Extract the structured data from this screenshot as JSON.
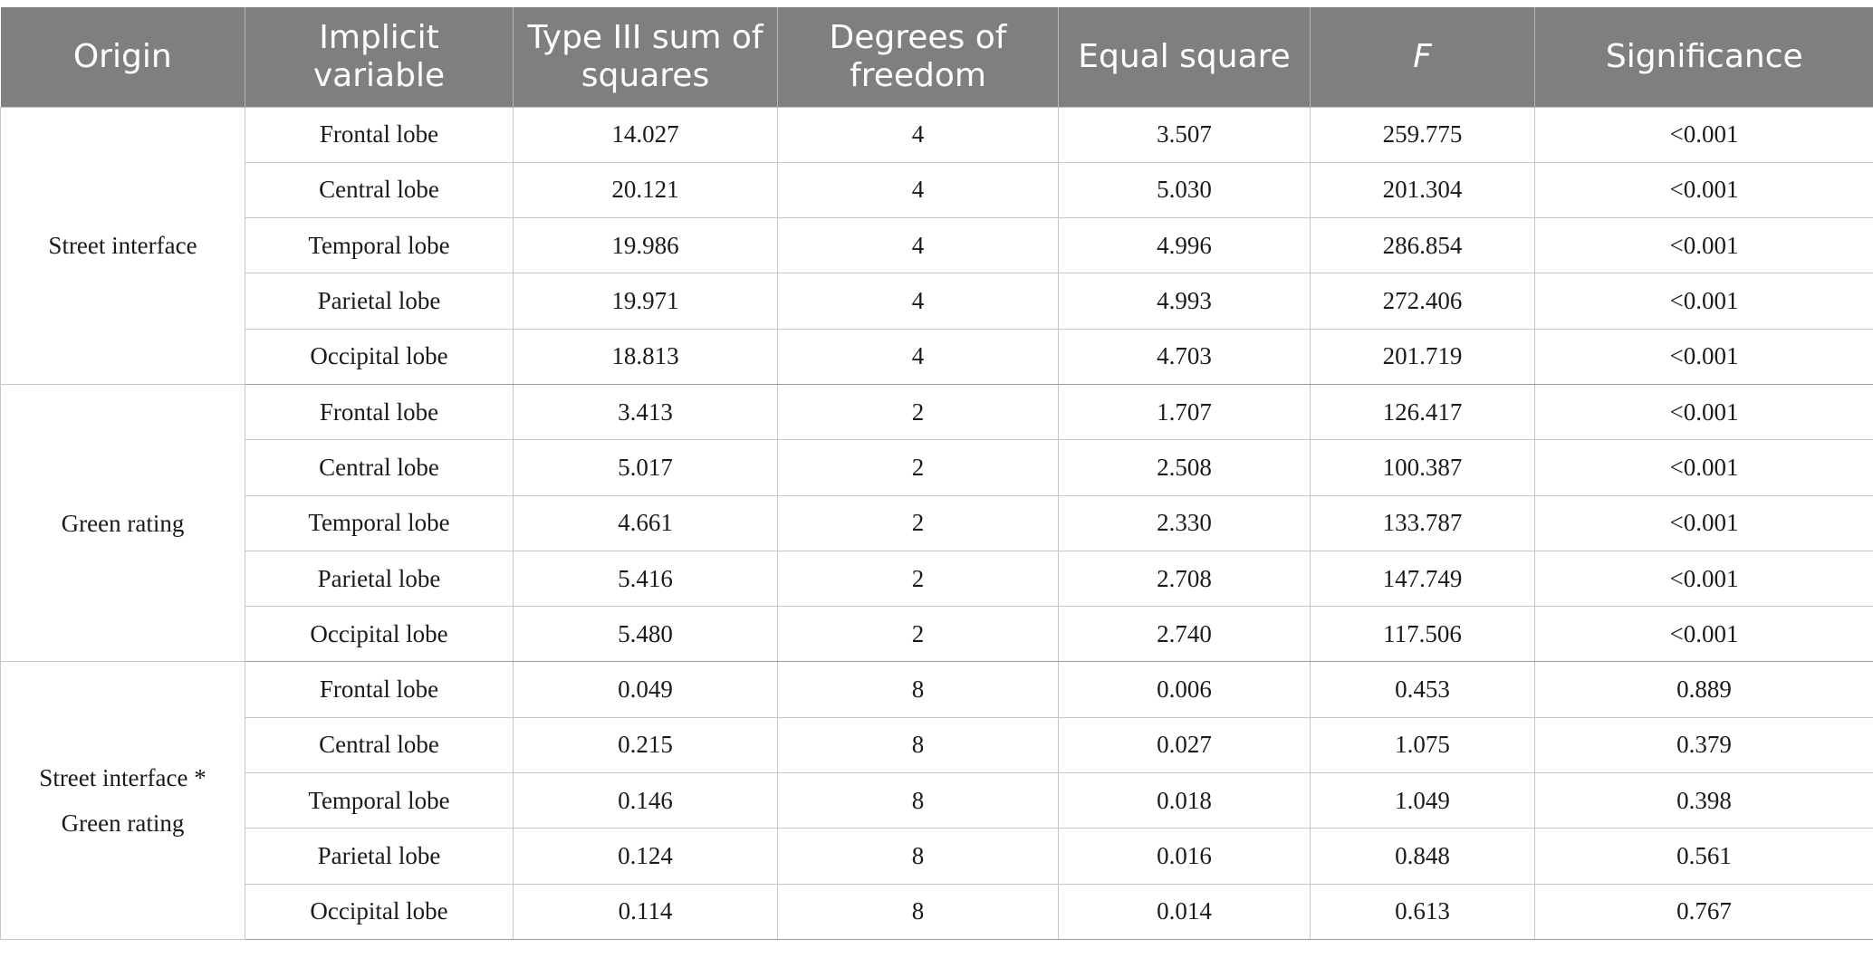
{
  "table": {
    "headers": {
      "origin": "Origin",
      "implicit_variable": "Implicit variable",
      "type3_ss": "Type III sum of squares",
      "df": "Degrees of freedom",
      "equal_square": "Equal square",
      "f": "F",
      "significance": "Significance"
    },
    "groups": [
      {
        "origin": "Street interface",
        "rows": [
          [
            "Frontal lobe",
            "14.027",
            "4",
            "3.507",
            "259.775",
            "<0.001"
          ],
          [
            "Central lobe",
            "20.121",
            "4",
            "5.030",
            "201.304",
            "<0.001"
          ],
          [
            "Temporal lobe",
            "19.986",
            "4",
            "4.996",
            "286.854",
            "<0.001"
          ],
          [
            "Parietal lobe",
            "19.971",
            "4",
            "4.993",
            "272.406",
            "<0.001"
          ],
          [
            "Occipital lobe",
            "18.813",
            "4",
            "4.703",
            "201.719",
            "<0.001"
          ]
        ]
      },
      {
        "origin": "Green rating",
        "rows": [
          [
            "Frontal lobe",
            "3.413",
            "2",
            "1.707",
            "126.417",
            "<0.001"
          ],
          [
            "Central lobe",
            "5.017",
            "2",
            "2.508",
            "100.387",
            "<0.001"
          ],
          [
            "Temporal lobe",
            "4.661",
            "2",
            "2.330",
            "133.787",
            "<0.001"
          ],
          [
            "Parietal lobe",
            "5.416",
            "2",
            "2.708",
            "147.749",
            "<0.001"
          ],
          [
            "Occipital lobe",
            "5.480",
            "2",
            "2.740",
            "117.506",
            "<0.001"
          ]
        ]
      },
      {
        "origin": "Street interface *\nGreen rating",
        "rows": [
          [
            "Frontal lobe",
            "0.049",
            "8",
            "0.006",
            "0.453",
            "0.889"
          ],
          [
            "Central lobe",
            "0.215",
            "8",
            "0.027",
            "1.075",
            "0.379"
          ],
          [
            "Temporal lobe",
            "0.146",
            "8",
            "0.018",
            "1.049",
            "0.398"
          ],
          [
            "Parietal lobe",
            "0.124",
            "8",
            "0.016",
            "0.848",
            "0.561"
          ],
          [
            "Occipital lobe",
            "0.114",
            "8",
            "0.014",
            "0.613",
            "0.767"
          ]
        ]
      }
    ]
  }
}
